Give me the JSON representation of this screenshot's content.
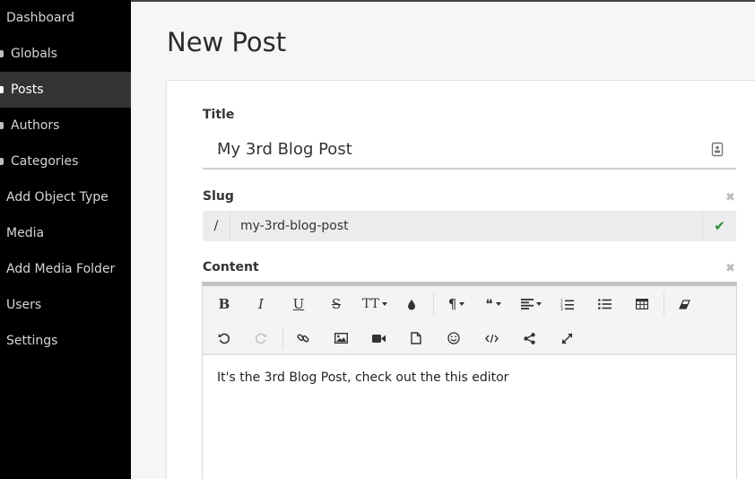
{
  "sidebar": {
    "items": [
      {
        "label": "Dashboard"
      },
      {
        "label": "Globals"
      },
      {
        "label": "Posts",
        "active": true
      },
      {
        "label": "Authors"
      },
      {
        "label": "Categories"
      },
      {
        "label": "Add Object Type"
      },
      {
        "label": "Media"
      },
      {
        "label": "Add Media Folder"
      },
      {
        "label": "Users"
      },
      {
        "label": "Settings"
      }
    ]
  },
  "page": {
    "title": "New Post"
  },
  "form": {
    "title": {
      "label": "Title",
      "value": "My 3rd Blog Post"
    },
    "slug": {
      "label": "Slug",
      "prefix": "/",
      "value": "my-3rd-blog-post",
      "clear": "✖",
      "valid": "✔"
    },
    "content": {
      "label": "Content",
      "clear": "✖",
      "body": "It's the 3rd Blog Post, check out the this editor",
      "toolbar": {
        "bold": "B",
        "italic": "I",
        "underline": "U",
        "strike": "S",
        "font_size": "TT",
        "paragraph": "¶",
        "quote": "❝"
      }
    }
  },
  "colors": {
    "sidebar_bg": "#000000",
    "active_bg": "#333333",
    "valid_check": "#2e8b3c"
  }
}
